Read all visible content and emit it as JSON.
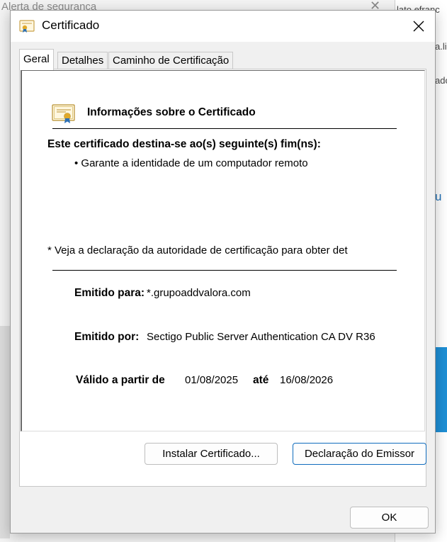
{
  "background": {
    "title": "Alerta de segurança",
    "right_texts": [
      "lato efranc",
      "a.li",
      "ado",
      "u"
    ]
  },
  "dialog": {
    "title": "Certificado",
    "tabs": [
      {
        "label": "Geral",
        "active": true
      },
      {
        "label": "Detalhes",
        "active": false
      },
      {
        "label": "Caminho de Certificação",
        "active": false
      }
    ],
    "heading": "Informações sobre o Certificado",
    "purpose_title": "Este certificado destina-se ao(s) seguinte(s) fim(ns):",
    "purpose_items": [
      "• Garante a identidade de um computador remoto"
    ],
    "note": "* Veja a declaração da autoridade de certificação para obter det",
    "issued_to_label": "Emitido para:",
    "issued_to_value": "*.grupoaddvalora.com",
    "issued_by_label": "Emitido por:",
    "issued_by_value": "Sectigo Public Server Authentication CA DV R36",
    "valid_from_label": "Válido a partir de",
    "valid_from_value": "01/08/2025",
    "valid_to_label": "até",
    "valid_to_value": "16/08/2026",
    "install_button": "Instalar Certificado...",
    "issuer_statement_button": "Declaração do Emissor",
    "ok_button": "OK"
  },
  "colors": {
    "focus_border": "#0f6cbd",
    "cert_ribbon": "#2c6fb5",
    "cert_seal": "#e0a92b"
  }
}
